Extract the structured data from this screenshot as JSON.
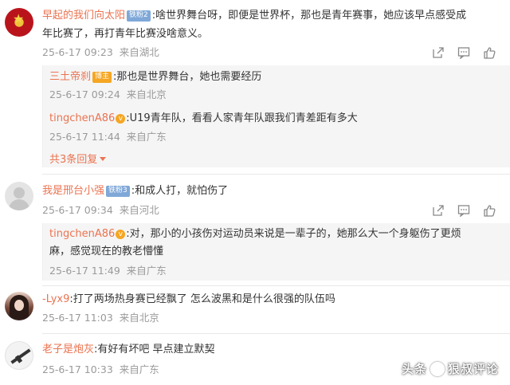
{
  "comments": [
    {
      "user": "早起的我们向太阳",
      "badge": "铁粉2",
      "text_line1": ":啥世界舞台呀，即便是世界杯，那也是青年赛事，她应该早点感受成",
      "text_line2": "年比赛了，再打青年比赛没啥意义。",
      "time": "25-6-17 09:23",
      "location": "来自湖北",
      "replies": [
        {
          "user": "三土帝刹",
          "badge": "博主",
          "text": ":那也是世界舞台，她也需要经历",
          "time": "25-6-17 09:24",
          "location": "来自北京"
        },
        {
          "user": "tingchenA86",
          "verified": "v",
          "text": ":U19青年队，看看人家青年队跟我们青差距有多大",
          "time": "25-6-17 11:44",
          "location": "来自广东"
        }
      ],
      "expand": "共3条回复"
    },
    {
      "user": "我是邢台小强",
      "badge": "铁粉3",
      "text": ":和成人打，就怕伤了",
      "time": "25-6-17 09:34",
      "location": "来自河北",
      "replies": [
        {
          "user": "tingchenA86",
          "verified": "v",
          "text_line1": ":对，那小的小孩伤对运动员来说是一辈子的，她那么大一个身躯伤了更烦",
          "text_line2": "麻，感觉现在的教老懵懂",
          "time": "25-6-17 11:49",
          "location": "来自广东"
        }
      ]
    },
    {
      "user": "-Lyx9",
      "text": ":打了两场热身赛已经飘了 怎么波黑和是什么很强的队伍吗",
      "time": "25-6-17 11:03",
      "location": "来自北京"
    },
    {
      "user": "老子是炮灰",
      "text": ":有好有坏吧 早点建立默契",
      "time": "25-6-17 10:33",
      "location": "来自广东"
    }
  ],
  "watermark": {
    "prefix": "头条",
    "name": "狠叔评论"
  },
  "icons": [
    "share-icon",
    "comment-icon",
    "like-icon"
  ],
  "colors": {
    "username": "#eb7350",
    "meta": "#9a9a9a",
    "reply_bg": "#f5f5f5"
  }
}
